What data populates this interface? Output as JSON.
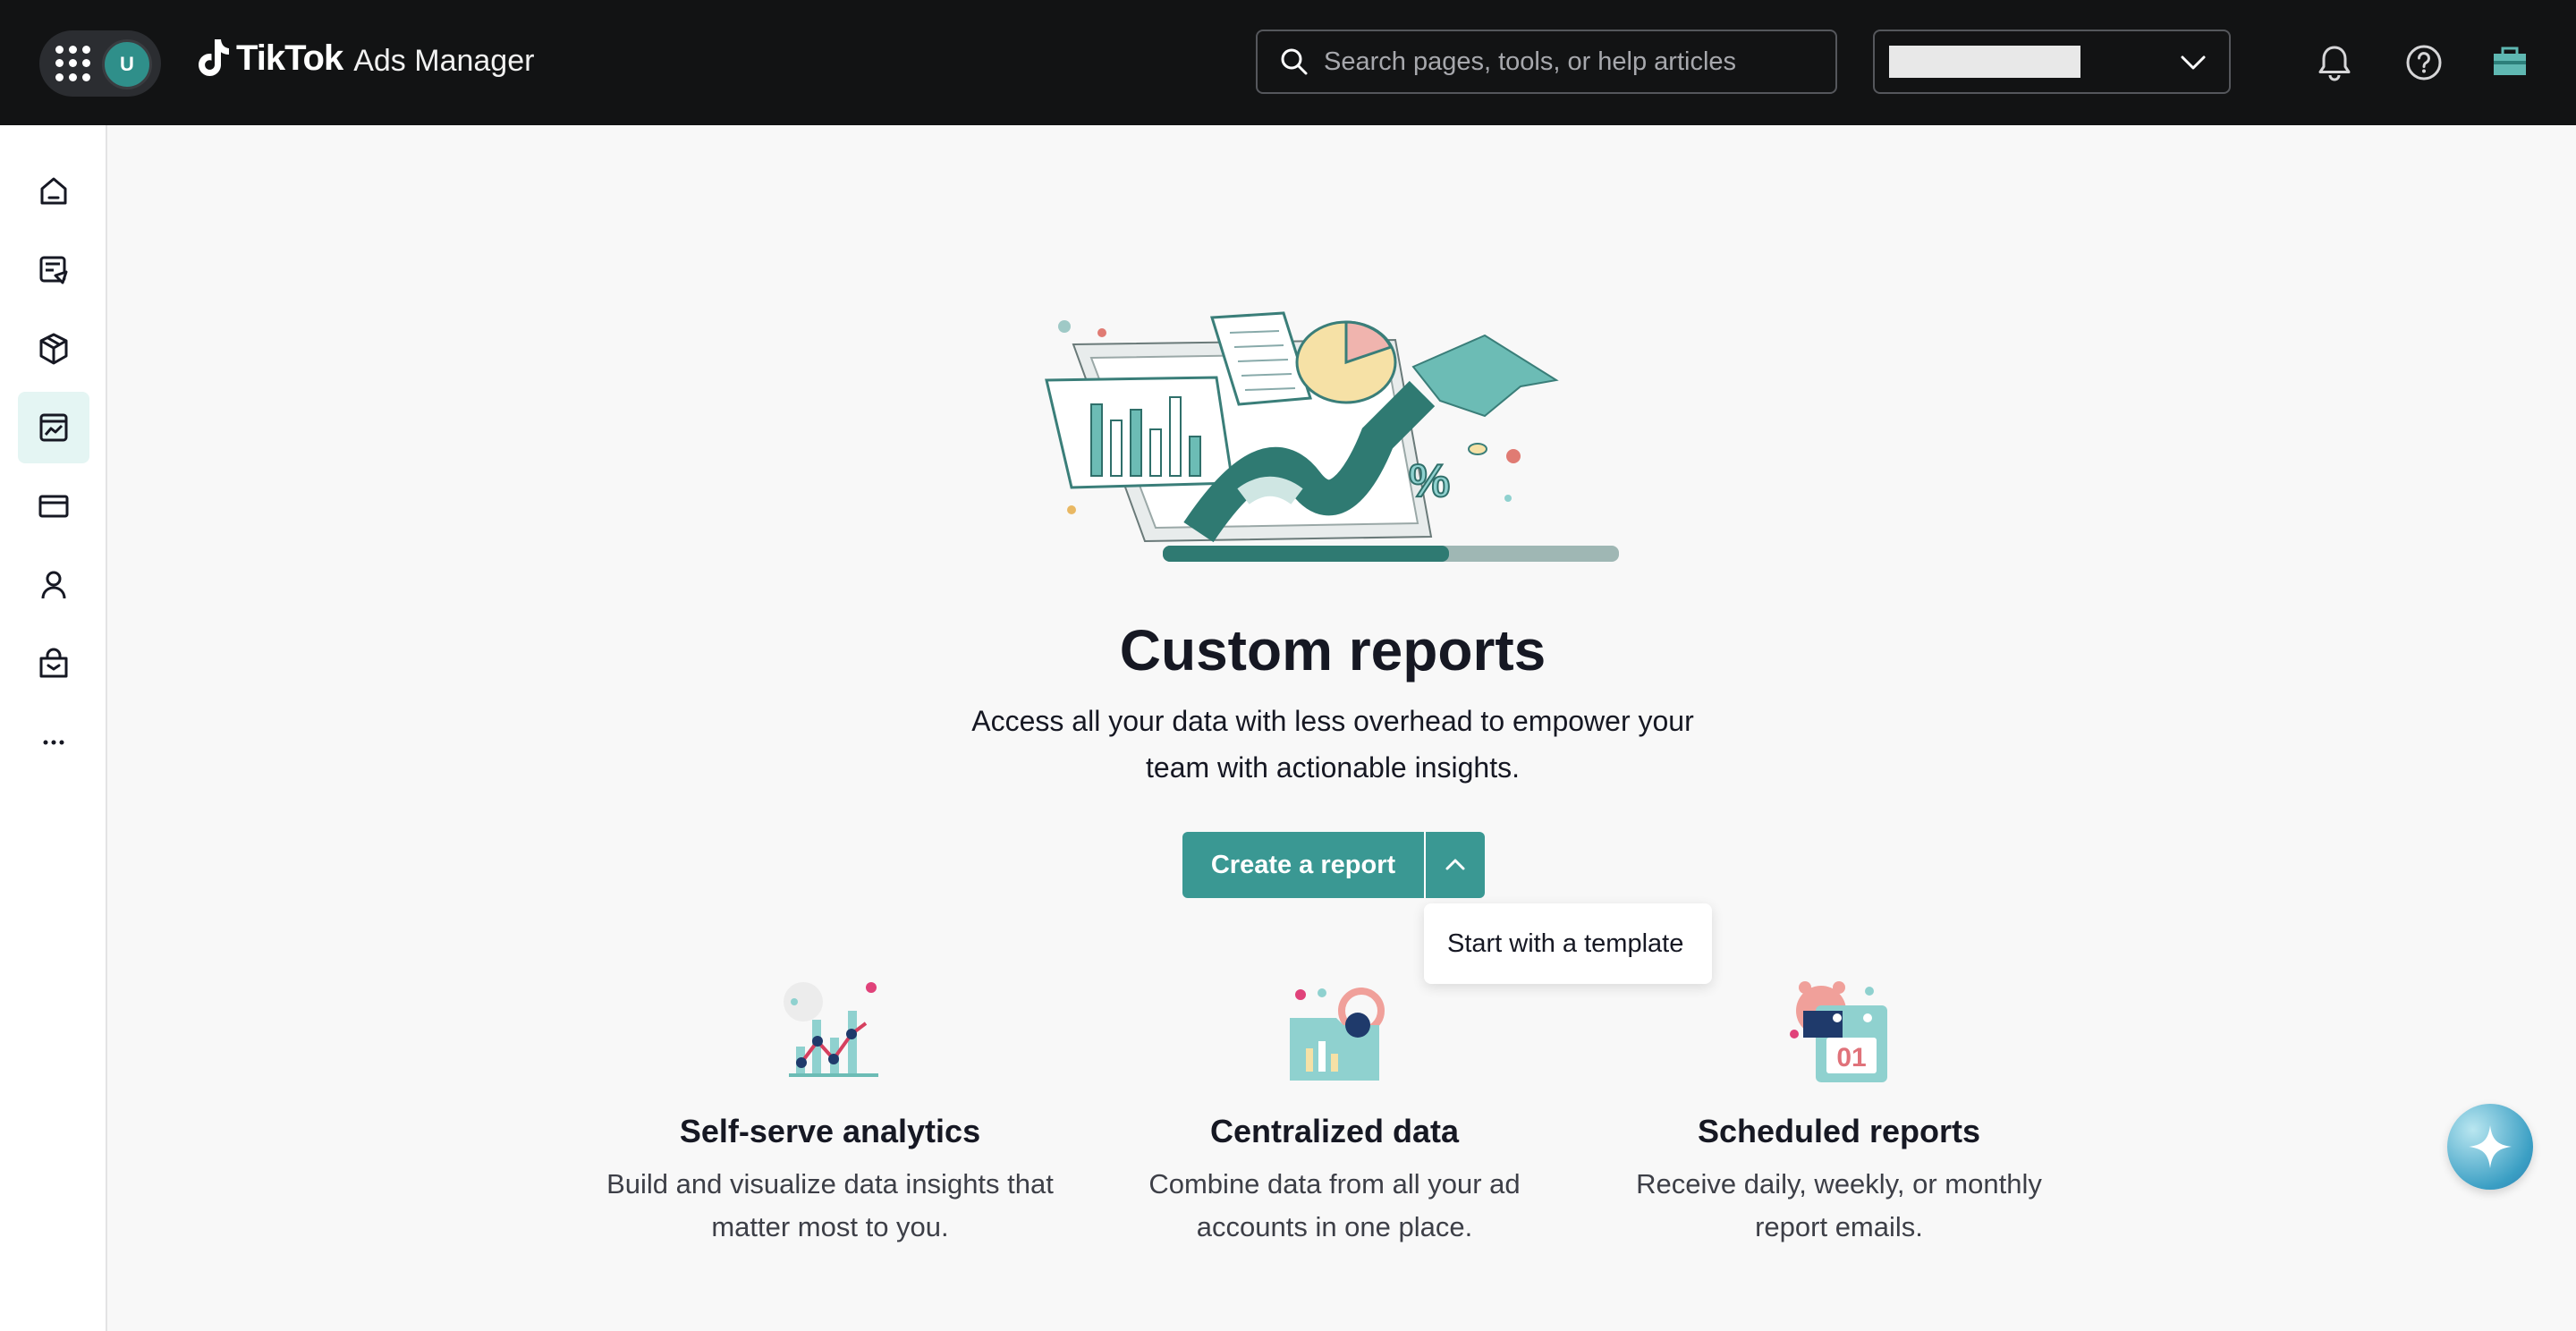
{
  "header": {
    "avatar_initial": "U",
    "brand_name": "TikTok",
    "brand_sub": "Ads Manager",
    "search_placeholder": "Search pages, tools, or help articles"
  },
  "sidebar": {
    "items": [
      {
        "icon": "home-icon"
      },
      {
        "icon": "campaign-icon"
      },
      {
        "icon": "assets-icon"
      },
      {
        "icon": "reporting-icon",
        "active": true
      },
      {
        "icon": "payment-icon"
      },
      {
        "icon": "audience-icon"
      },
      {
        "icon": "shop-icon"
      },
      {
        "icon": "more-icon"
      }
    ]
  },
  "main": {
    "title": "Custom reports",
    "description": "Access all your data with less overhead to empower your team with actionable insights.",
    "create_button": "Create a report",
    "dropdown_item": "Start with a template",
    "features": [
      {
        "title": "Self-serve analytics",
        "desc": "Build and visualize data insights that matter most to you."
      },
      {
        "title": "Centralized data",
        "desc": "Combine data from all your ad accounts in one place."
      },
      {
        "title": "Scheduled reports",
        "desc": "Receive daily, weekly, or monthly report emails."
      }
    ]
  },
  "colors": {
    "accent": "#3a9893",
    "topbar": "#121314"
  }
}
